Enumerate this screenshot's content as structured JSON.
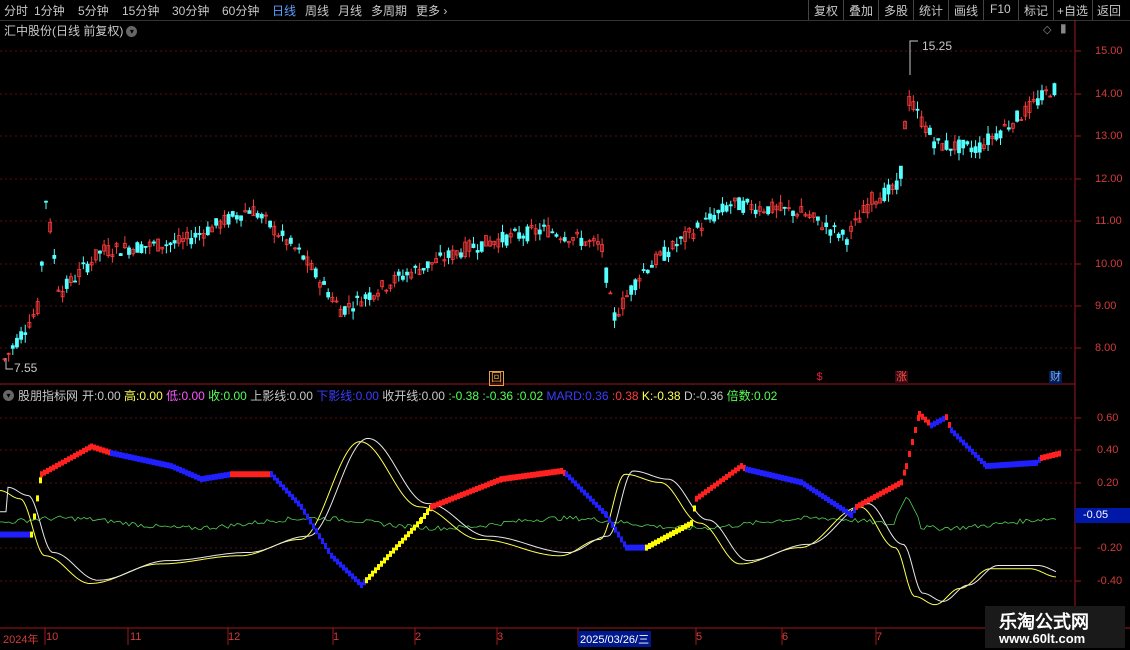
{
  "toolbar": {
    "periods": [
      "分时",
      "1分钟",
      "5分钟",
      "15分钟",
      "30分钟",
      "60分钟",
      "日线",
      "周线",
      "月线",
      "多周期",
      "更多"
    ],
    "active_period": "日线",
    "more_arrow": "›",
    "actions": [
      "复权",
      "叠加",
      "多股",
      "统计",
      "画线",
      "F10",
      "标记",
      "+自选",
      "返回"
    ]
  },
  "main_chart": {
    "stock_title": "汇中股份(日线 前复权)",
    "high_marker": "15.25",
    "low_marker": "7.55",
    "y_axis": [
      "15.00",
      "14.00",
      "13.00",
      "12.00",
      "11.00",
      "10.00",
      "9.00",
      "8.00"
    ],
    "events": [
      {
        "symbol": "回",
        "color": "#e8a040"
      },
      {
        "symbol": "$",
        "color": "#e0203c"
      },
      {
        "symbol": "涨",
        "color": "#e0203c"
      },
      {
        "symbol": "财",
        "color": "#3a8cff"
      }
    ],
    "colors": {
      "up": "#ff3c3c",
      "down": "#54ffff"
    }
  },
  "indicator": {
    "name": "股朋指标网",
    "fields": [
      {
        "label": "开:",
        "value": "0.00",
        "color": "#c8c8c8"
      },
      {
        "label": "高:",
        "value": "0.00",
        "color": "#ffff54"
      },
      {
        "label": "低:",
        "value": "0.00",
        "color": "#ff54ff"
      },
      {
        "label": "收:",
        "value": "0.00",
        "color": "#54ff54"
      },
      {
        "label": "上影线:",
        "value": "0.00",
        "color": "#c8c8c8"
      },
      {
        "label": "下影线:",
        "value": "0.00",
        "color": "#3c3cff"
      },
      {
        "label": "收开线:",
        "value": "0.00",
        "color": "#c8c8c8"
      },
      {
        "label": ":",
        "value": "-0.38",
        "color": "#54ff54"
      },
      {
        "label": ":",
        "value": "-0.36",
        "color": "#54ff54"
      },
      {
        "label": ":",
        "value": "0.02",
        "color": "#54ff54"
      },
      {
        "label": "MARD:",
        "value": "0.36",
        "color": "#3c3cff"
      },
      {
        "label": ":",
        "value": "0.38",
        "color": "#ff3c3c"
      },
      {
        "label": "K:",
        "value": "-0.38",
        "color": "#ffff54"
      },
      {
        "label": "D:",
        "value": "-0.36",
        "color": "#c8c8c8"
      },
      {
        "label": "倍数:",
        "value": "0.02",
        "color": "#54ff54"
      }
    ],
    "y_axis": [
      "0.60",
      "0.40",
      "0.20",
      "-0.05",
      "-0.20",
      "-0.40"
    ],
    "current_value": "-0.05"
  },
  "x_axis": {
    "labels": [
      "2024年",
      "10",
      "11",
      "12",
      "1",
      "2",
      "3",
      "2025/03/26/三",
      "5",
      "6",
      "7"
    ]
  },
  "watermark": {
    "line1": "乐淘公式网",
    "line2": "www.60lt.com"
  }
}
